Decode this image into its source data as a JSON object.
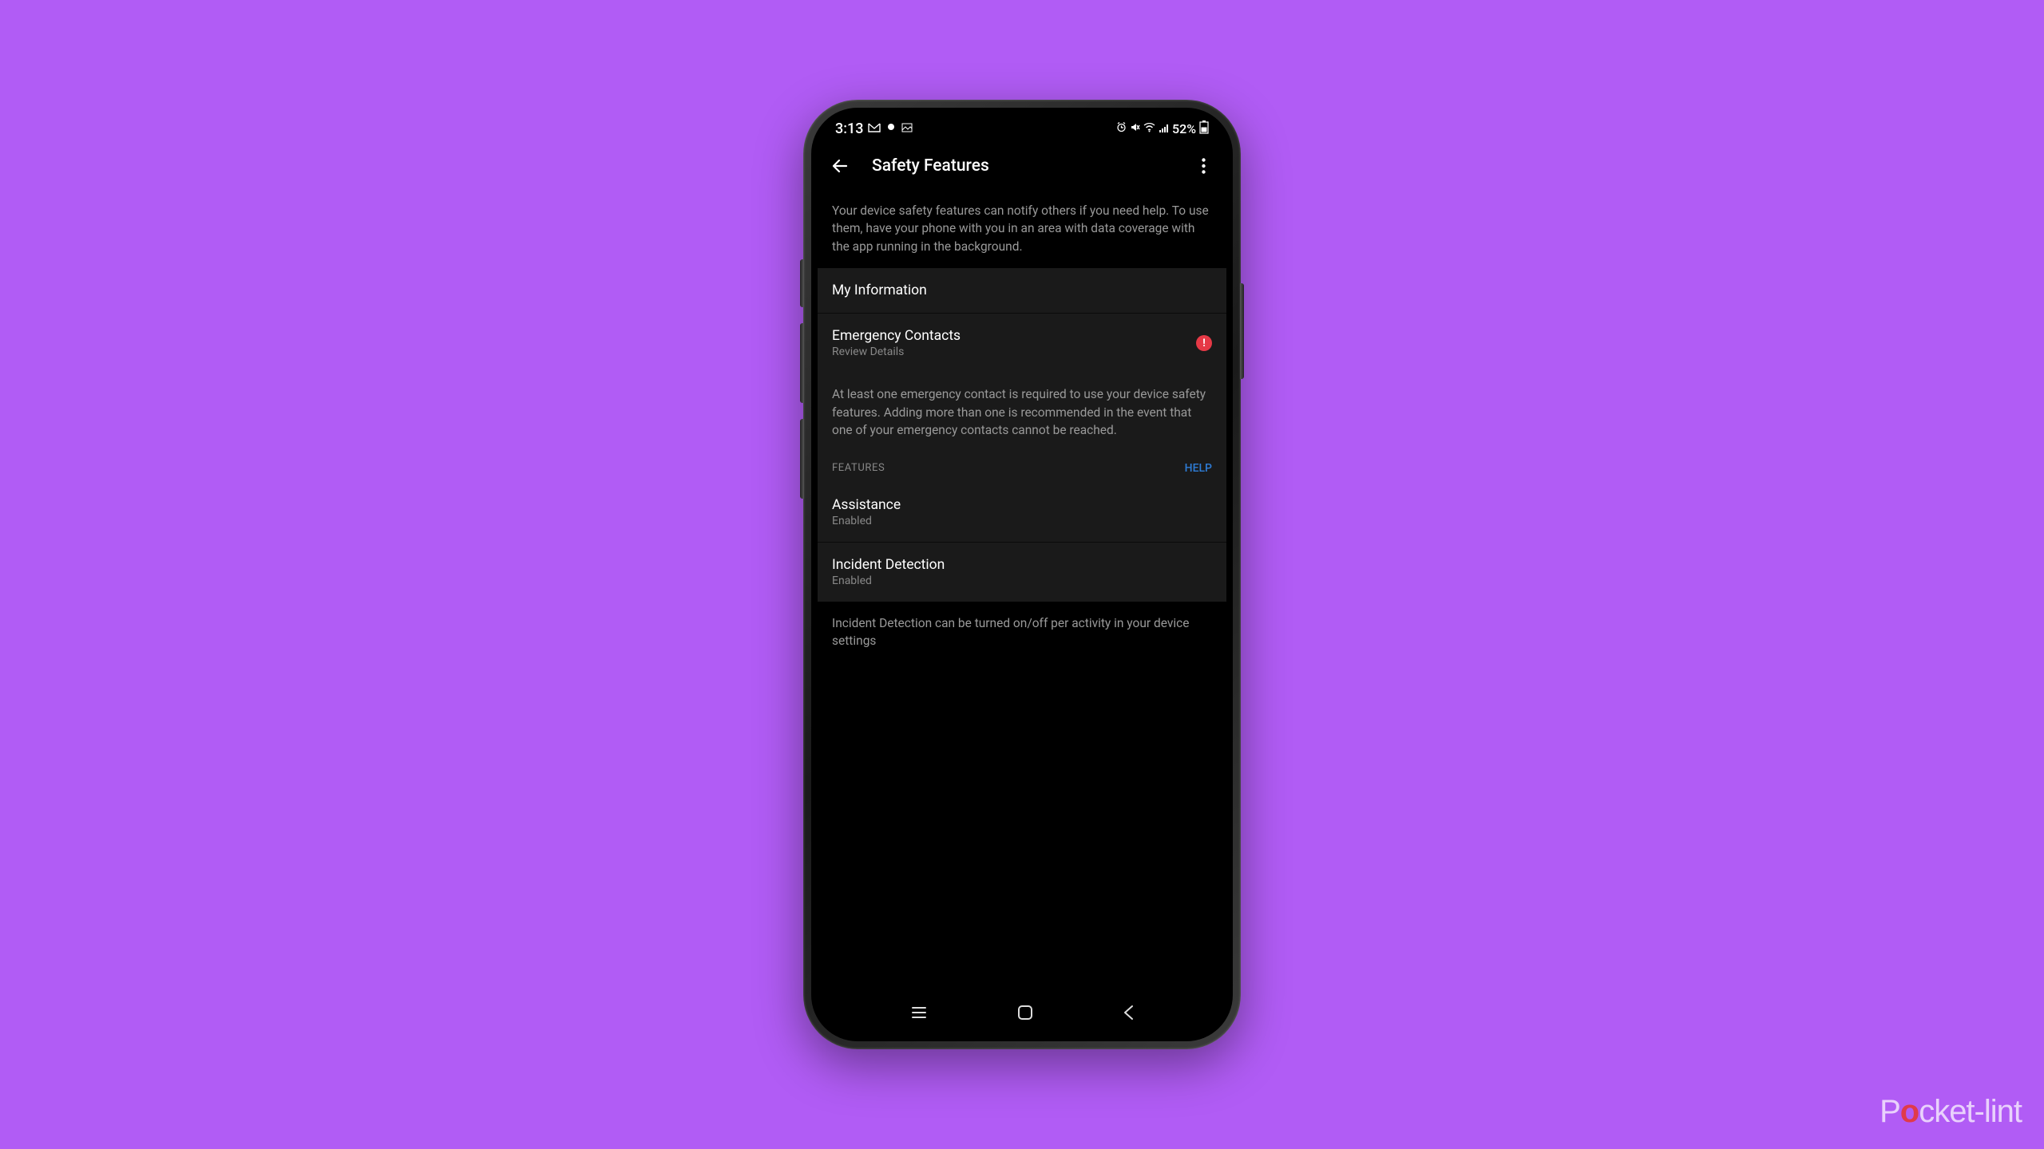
{
  "status_bar": {
    "time": "3:13",
    "battery_text": "52%"
  },
  "header": {
    "title": "Safety Features"
  },
  "intro": "Your device safety features can notify others if you need help. To use them, have your phone with you in an area with data coverage with the app running in the background.",
  "my_info": {
    "title": "My Information"
  },
  "emergency_contacts": {
    "title": "Emergency Contacts",
    "subtitle": "Review Details",
    "alert": "!"
  },
  "emergency_note": "At least one emergency contact is required to use your device safety features. Adding more than one is recommended in the event that one of your emergency contacts cannot be reached.",
  "features_header": {
    "label": "FEATURES",
    "help": "HELP"
  },
  "assistance": {
    "title": "Assistance",
    "status": "Enabled"
  },
  "incident": {
    "title": "Incident Detection",
    "status": "Enabled"
  },
  "incident_note": "Incident Detection can be turned on/off per activity in your device settings",
  "watermark": {
    "prefix": "P",
    "accent": "o",
    "suffix": "cket-lint"
  }
}
